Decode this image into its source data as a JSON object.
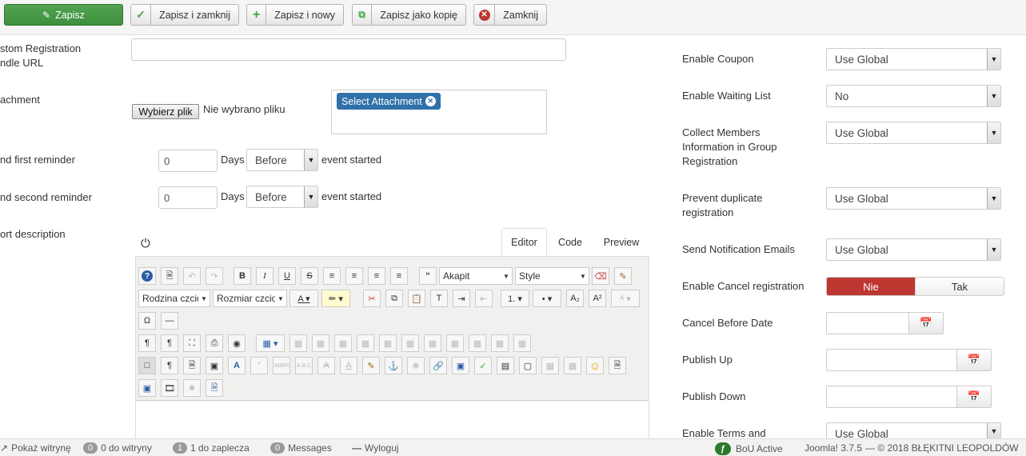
{
  "toolbar": {
    "save": "Zapisz",
    "save_close": "Zapisz i zamknij",
    "save_new": "Zapisz i nowy",
    "save_copy": "Zapisz jako kopię",
    "close": "Zamknij"
  },
  "left": {
    "custom_reg_label": "stom Registration\nndle URL",
    "attachment_label": "achment",
    "file_button": "Wybierz plik",
    "file_status": "Nie wybrano pliku",
    "select_attachment": "Select Attachment",
    "first_reminder_label": "nd first reminder",
    "second_reminder_label": "nd second reminder",
    "first_reminder_value": "0",
    "second_reminder_value": "0",
    "days": "Days",
    "before": "Before",
    "event_started": "event started",
    "short_desc_label": "ort description"
  },
  "editor": {
    "tabs": [
      "Editor",
      "Code",
      "Preview"
    ],
    "format_select": "Akapit",
    "style_select": "Style",
    "font_family": "Rodzina czcionki",
    "font_size": "Rozmiar czcionki"
  },
  "right": {
    "enable_coupon": {
      "label": "Enable Coupon",
      "value": "Use Global"
    },
    "enable_waiting": {
      "label": "Enable Waiting List",
      "value": "No"
    },
    "collect_members": {
      "label": "Collect Members\nInformation in Group\nRegistration",
      "value": "Use Global"
    },
    "prevent_dup": {
      "label": "Prevent duplicate\nregistration",
      "value": "Use Global"
    },
    "send_notif": {
      "label": "Send Notification Emails",
      "value": "Use Global"
    },
    "enable_cancel": {
      "label": "Enable Cancel registration",
      "no": "Nie",
      "yes": "Tak"
    },
    "cancel_before": {
      "label": "Cancel Before Date"
    },
    "publish_up": {
      "label": "Publish Up"
    },
    "publish_down": {
      "label": "Publish Down"
    },
    "enable_terms": {
      "label": "Enable Terms and",
      "value": "Use Global"
    }
  },
  "status": {
    "view_site": "Pokaż witrynę",
    "site_count": "0",
    "site_label": "do witryny",
    "admin_count": "1",
    "admin_label": "do zaplecza",
    "msg_count": "0",
    "messages": "Messages",
    "logout": "Wyloguj",
    "bou": "BoU Active",
    "joomla": "Joomla! 3.7.5",
    "copyright": "— © 2018 BŁĘKITNI LEOPOLDÓW"
  },
  "colors": {
    "green": "#46a546",
    "red": "#bd362f",
    "blue": "#3071a9"
  }
}
